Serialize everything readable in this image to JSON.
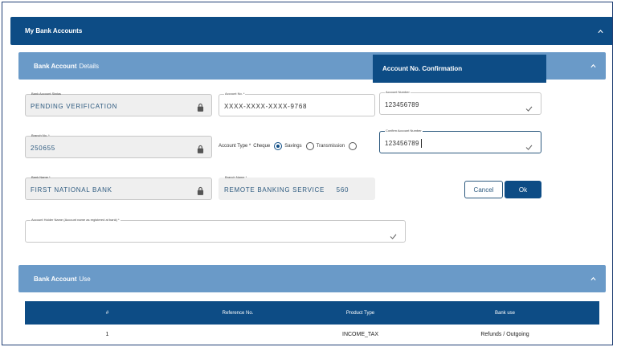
{
  "top_section": {
    "title": "My Bank Accounts"
  },
  "details_section": {
    "title_bold": "Bank Account",
    "title_rest": "Details"
  },
  "fields": {
    "status": {
      "label": "Bank Account Status",
      "value": "PENDING VERIFICATION"
    },
    "account_no": {
      "label": "Account No. *",
      "value": "XXXX-XXXX-XXXX-9768"
    },
    "branch_no": {
      "label": "Branch No. *",
      "value": "250655"
    },
    "bank_name": {
      "label": "Bank Name *",
      "value": "FIRST NATIONAL BANK"
    },
    "branch_name": {
      "label": "Branch Name *",
      "value": "REMOTE BANKING SERVICE     560"
    },
    "holder_name": {
      "label": "Account Holder Name (Account name as registered at bank) *",
      "value": ""
    }
  },
  "account_type": {
    "label": "Account Type *",
    "options": [
      "Cheque",
      "Savings",
      "Transmission"
    ],
    "selected": "Cheque"
  },
  "confirmation": {
    "title": "Account No. Confirmation",
    "account_number": {
      "label": "Account Number",
      "value": "123456789"
    },
    "confirm_account_number": {
      "label": "Confirm Account Number",
      "value": "123456789"
    },
    "cancel_label": "Cancel",
    "ok_label": "Ok"
  },
  "use_section": {
    "title_bold": "Bank Account",
    "title_rest": "Use"
  },
  "use_table": {
    "headers": [
      "#",
      "Reference No.",
      "Product Type",
      "Bank use"
    ],
    "rows": [
      [
        "1",
        "",
        "INCOME_TAX",
        "Refunds / Outgoing"
      ]
    ]
  }
}
